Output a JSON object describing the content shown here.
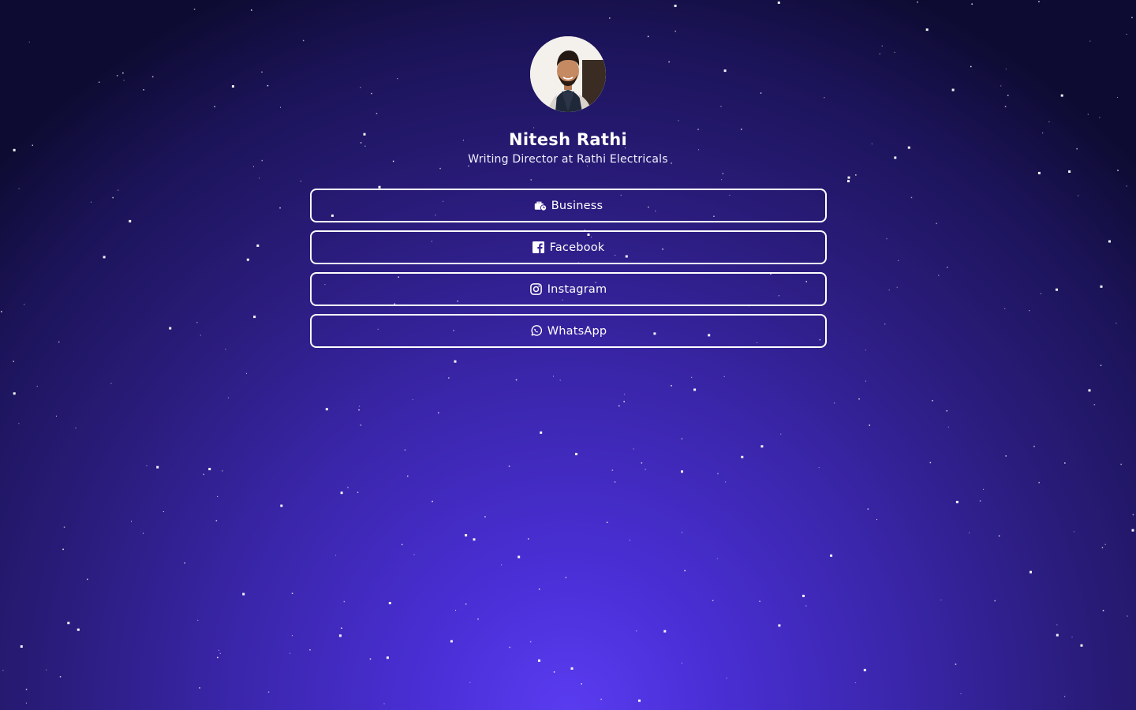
{
  "profile": {
    "name": "Nitesh Rathi",
    "bio": "Writing Director at Rathi Electricals"
  },
  "links": [
    {
      "label": "Business",
      "icon": "business-time-icon"
    },
    {
      "label": "Facebook",
      "icon": "facebook-square-icon"
    },
    {
      "label": "Instagram",
      "icon": "instagram-icon"
    },
    {
      "label": "WhatsApp",
      "icon": "whatsapp-icon"
    }
  ],
  "colors": {
    "background_center": "#5a3cf0",
    "background_edge": "#0e0b33",
    "text": "#ffffff",
    "button_border": "#ffffff"
  }
}
